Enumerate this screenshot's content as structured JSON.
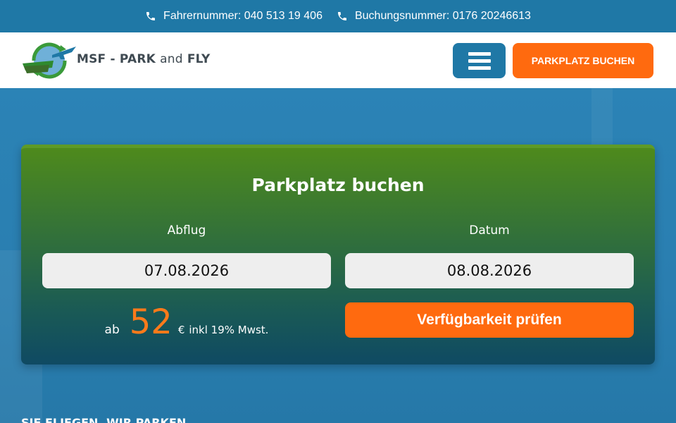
{
  "topbar": {
    "driver_label": "Fahrernummer: 040 513 19 406",
    "booking_label": "Buchungsnummer: 0176 20246613"
  },
  "header": {
    "logo_text_main": "MSF - PARK",
    "logo_text_and": "and",
    "logo_text_fly": "FLY",
    "book_button": "PARKPLATZ BUCHEN"
  },
  "booking": {
    "title": "Parkplatz buchen",
    "departure_label": "Abflug",
    "departure_value": "07.08.2026",
    "date_label": "Datum",
    "date_value": "08.08.2026",
    "price_prefix": "ab",
    "price_amount": "52",
    "price_currency": "€",
    "price_tax": "inkl 19% Mwst.",
    "check_button": "Verfügbarkeit prüfen"
  },
  "hero": {
    "slogan": "SIE FLIEGEN, WIR PARKEN"
  },
  "colors": {
    "brand_blue": "#1f78a6",
    "accent_orange": "#ff6a0f",
    "card_green": "#4e8a1c",
    "card_teal": "#0f4a63"
  },
  "icons": {
    "phone": "phone-icon",
    "menu": "hamburger-menu-icon",
    "logo": "globe-airplane-logo"
  }
}
